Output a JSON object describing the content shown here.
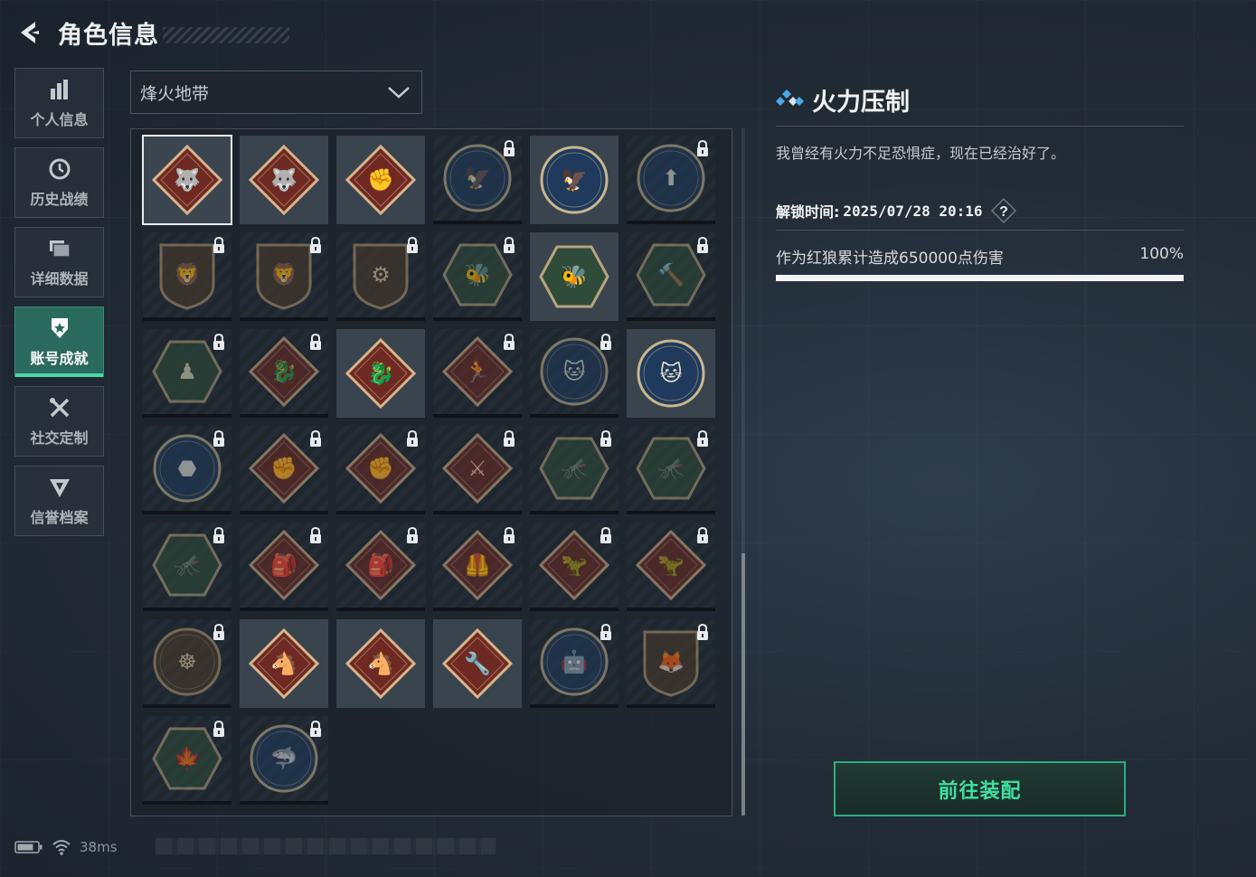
{
  "header": {
    "title": "角色信息"
  },
  "sidebar": {
    "items": [
      {
        "label": "个人信息",
        "icon": "bar-chart-icon",
        "active": false
      },
      {
        "label": "历史战绩",
        "icon": "clock-icon",
        "active": false
      },
      {
        "label": "详细数据",
        "icon": "stacked-cards-icon",
        "active": false
      },
      {
        "label": "账号成就",
        "icon": "medal-icon",
        "active": true
      },
      {
        "label": "社交定制",
        "icon": "tools-icon",
        "active": false
      },
      {
        "label": "信誉档案",
        "icon": "shield-wing-icon",
        "active": false
      }
    ]
  },
  "season_select": {
    "selected": "烽火地带"
  },
  "badges": [
    {
      "name": "wolf-badge",
      "shape": "diamond",
      "palette": "red",
      "glyph": "🐺",
      "locked": false,
      "selected": true
    },
    {
      "name": "wolf-badge-2",
      "shape": "diamond",
      "palette": "red",
      "glyph": "🐺",
      "locked": false
    },
    {
      "name": "fist-badge",
      "shape": "diamond",
      "palette": "red",
      "glyph": "✊",
      "locked": false
    },
    {
      "name": "eagle-badge",
      "shape": "circle",
      "palette": "blue",
      "glyph": "🦅",
      "locked": true
    },
    {
      "name": "eagle-badge-2",
      "shape": "circle",
      "palette": "blue",
      "glyph": "🦅",
      "locked": false
    },
    {
      "name": "arrow-badge",
      "shape": "circle",
      "palette": "blue",
      "glyph": "⬆",
      "locked": true
    },
    {
      "name": "lion-badge",
      "shape": "shield",
      "palette": "brown",
      "glyph": "🦁",
      "locked": true
    },
    {
      "name": "lion-badge-2",
      "shape": "shield",
      "palette": "brown",
      "glyph": "🦁",
      "locked": true
    },
    {
      "name": "gear-badge",
      "shape": "shield",
      "palette": "brown",
      "glyph": "⚙",
      "locked": true
    },
    {
      "name": "wasp-badge",
      "shape": "hexagon",
      "palette": "green",
      "glyph": "🐝",
      "locked": true
    },
    {
      "name": "wasp-badge-2",
      "shape": "hexagon",
      "palette": "green",
      "glyph": "🐝",
      "locked": false
    },
    {
      "name": "hammer-badge",
      "shape": "hexagon",
      "palette": "green",
      "glyph": "🔨",
      "locked": true
    },
    {
      "name": "soldier-badge",
      "shape": "hexagon",
      "palette": "green",
      "glyph": "♟",
      "locked": true
    },
    {
      "name": "dragon-badge",
      "shape": "diamond",
      "palette": "red",
      "glyph": "🐉",
      "locked": true
    },
    {
      "name": "dragon-badge-2",
      "shape": "diamond",
      "palette": "red",
      "glyph": "🐉",
      "locked": false
    },
    {
      "name": "runner-badge",
      "shape": "diamond",
      "palette": "red",
      "glyph": "🏃",
      "locked": true
    },
    {
      "name": "lynx-badge",
      "shape": "circle",
      "palette": "blue",
      "glyph": "🐱",
      "locked": true
    },
    {
      "name": "lynx-badge-2",
      "shape": "circle",
      "palette": "blue",
      "glyph": "🐱",
      "locked": false
    },
    {
      "name": "rock-badge",
      "shape": "circle",
      "palette": "blue",
      "glyph": "⬣",
      "locked": true
    },
    {
      "name": "fist-badge-2",
      "shape": "diamond",
      "palette": "red",
      "glyph": "✊",
      "locked": true
    },
    {
      "name": "fist-badge-3",
      "shape": "diamond",
      "palette": "red",
      "glyph": "✊",
      "locked": true
    },
    {
      "name": "rifle-badge",
      "shape": "diamond",
      "palette": "red",
      "glyph": "⚔",
      "locked": true
    },
    {
      "name": "dragonfly-badge",
      "shape": "hexagon",
      "palette": "green",
      "glyph": "🦟",
      "locked": true
    },
    {
      "name": "dragonfly-badge-2",
      "shape": "hexagon",
      "palette": "green",
      "glyph": "🦟",
      "locked": true
    },
    {
      "name": "dragonfly-badge-3",
      "shape": "hexagon",
      "palette": "green",
      "glyph": "🦟",
      "locked": true
    },
    {
      "name": "backpack-badge",
      "shape": "diamond",
      "palette": "red",
      "glyph": "🎒",
      "locked": true
    },
    {
      "name": "backpack-badge-2",
      "shape": "diamond",
      "palette": "red",
      "glyph": "🎒",
      "locked": true
    },
    {
      "name": "vest-badge",
      "shape": "diamond",
      "palette": "red",
      "glyph": "🦺",
      "locked": true
    },
    {
      "name": "raptor-badge",
      "shape": "diamond",
      "palette": "red",
      "glyph": "🦖",
      "locked": true
    },
    {
      "name": "raptor-badge-2",
      "shape": "diamond",
      "palette": "red",
      "glyph": "🦖",
      "locked": true
    },
    {
      "name": "wheel-badge",
      "shape": "circle",
      "palette": "brown",
      "glyph": "☸",
      "locked": true
    },
    {
      "name": "horse-badge",
      "shape": "diamond",
      "palette": "red",
      "glyph": "🐴",
      "locked": false
    },
    {
      "name": "horse-badge-2",
      "shape": "diamond",
      "palette": "red",
      "glyph": "🐴",
      "locked": false
    },
    {
      "name": "tools-badge",
      "shape": "diamond",
      "palette": "red",
      "glyph": "🔧",
      "locked": false
    },
    {
      "name": "mech-badge",
      "shape": "circle",
      "palette": "blue",
      "glyph": "🤖",
      "locked": true
    },
    {
      "name": "fox-badge",
      "shape": "shield",
      "palette": "brown",
      "glyph": "🦊",
      "locked": true
    },
    {
      "name": "leaf-badge",
      "shape": "hexagon",
      "palette": "green",
      "glyph": "🍁",
      "locked": true
    },
    {
      "name": "shark-badge",
      "shape": "circle",
      "palette": "blue",
      "glyph": "🦈",
      "locked": true
    }
  ],
  "detail": {
    "title": "火力压制",
    "description": "我曾经有火力不足恐惧症，现在已经治好了。",
    "unlock_label": "解锁时间:",
    "unlock_time": "2025/07/28 20:16",
    "task_text": "作为红狼累计造成650000点伤害",
    "progress_text": "100%",
    "progress": 1.0
  },
  "equip_button": {
    "label": "前往装配"
  },
  "status_bar": {
    "ping": "38ms"
  },
  "colors": {
    "accent_green": "#3ee0a1",
    "active_tab": "#2a6a5c",
    "title_icon_blue": "#4aa8e6"
  }
}
